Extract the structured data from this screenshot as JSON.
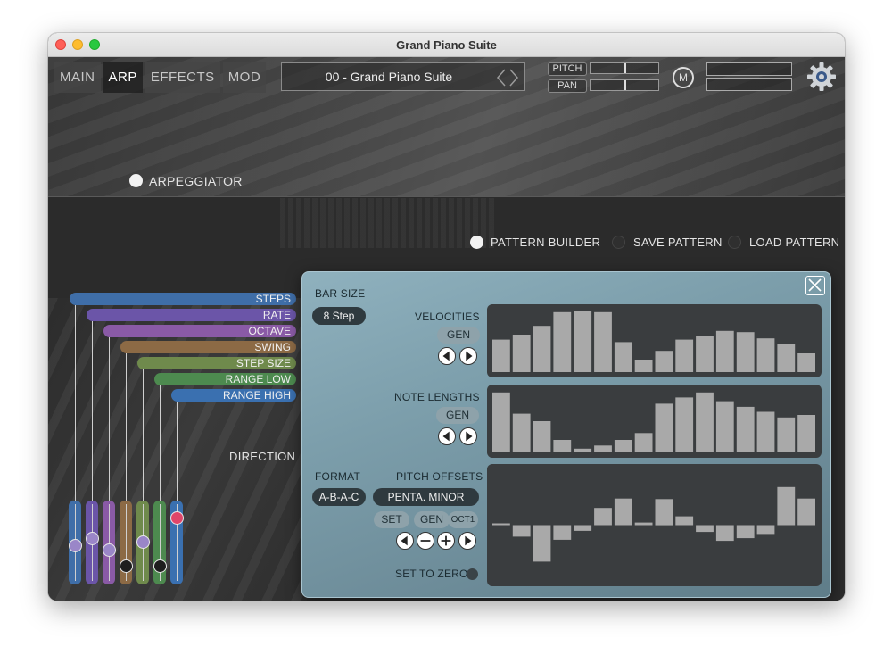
{
  "window": {
    "title": "Grand Piano Suite"
  },
  "tabs": [
    {
      "label": "MAIN",
      "active": false
    },
    {
      "label": "ARP",
      "active": true
    },
    {
      "label": "EFFECTS",
      "active": false
    },
    {
      "label": "MOD",
      "active": false
    }
  ],
  "preset": {
    "name": "00 - Grand Piano Suite"
  },
  "header": {
    "pitch_label": "PITCH",
    "pan_label": "PAN",
    "m_label": "M"
  },
  "arp": {
    "toggle_label": "ARPEGGIATOR",
    "pattern_builder_label": "PATTERN BUILDER",
    "save_pattern_label": "SAVE PATTERN",
    "load_pattern_label": "LOAD PATTERN",
    "direction_label": "DIRECTION"
  },
  "params": [
    {
      "label": "STEPS",
      "color": "#3f6ea8",
      "value": 0.45
    },
    {
      "label": "RATE",
      "color": "#6b55a8",
      "value": 0.55
    },
    {
      "label": "OCTAVE",
      "color": "#8a5aa6",
      "value": 0.38
    },
    {
      "label": "SWING",
      "color": "#8c6a45",
      "value": 0.15
    },
    {
      "label": "STEP SIZE",
      "color": "#6f8a4c",
      "value": 0.5
    },
    {
      "label": "RANGE LOW",
      "color": "#4d8a4f",
      "value": 0.15
    },
    {
      "label": "RANGE HIGH",
      "color": "#3a70b0",
      "value": 0.85
    }
  ],
  "builder": {
    "bar_size_label": "BAR SIZE",
    "bar_size_value": "8 Step",
    "velocities_label": "VELOCITIES",
    "note_lengths_label": "NOTE LENGTHS",
    "gen_label": "GEN",
    "format_label": "FORMAT",
    "format_value": "A-B-A-C",
    "pitch_offsets_label": "PITCH OFFSETS",
    "scale_value": "PENTA. MINOR",
    "set_label": "SET",
    "oct_label": "OCT1",
    "set_to_zero_label": "SET TO ZERO",
    "velocities": [
      0.52,
      0.6,
      0.74,
      0.96,
      0.98,
      0.96,
      0.48,
      0.2,
      0.34,
      0.52,
      0.58,
      0.66,
      0.64,
      0.54,
      0.45,
      0.3
    ],
    "note_lengths": [
      0.96,
      0.62,
      0.5,
      0.2,
      0.06,
      0.11,
      0.2,
      0.31,
      0.78,
      0.88,
      0.96,
      0.82,
      0.73,
      0.65,
      0.56,
      0.6
    ],
    "pitch_offsets": [
      0,
      -0.22,
      -0.7,
      -0.28,
      -0.11,
      0.33,
      0.51,
      0.05,
      0.5,
      0.17,
      -0.13,
      -0.3,
      -0.25,
      -0.17,
      0.73,
      0.51
    ]
  }
}
